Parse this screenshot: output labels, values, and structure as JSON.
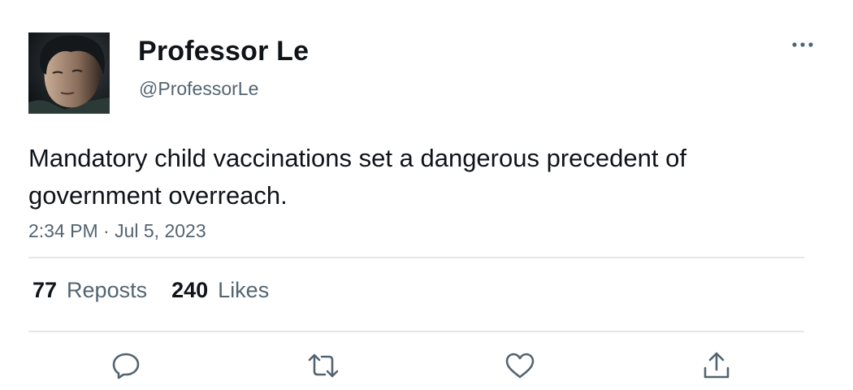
{
  "tweet": {
    "author": {
      "display_name": "Professor Le",
      "handle": "@ProfessorLe"
    },
    "text": "Mandatory child vaccinations set a dangerous precedent of government overreach.",
    "timestamp": "2:34 PM · Jul 5, 2023",
    "stats": {
      "reposts_count": "77",
      "reposts_label": "Reposts",
      "likes_count": "240",
      "likes_label": "Likes"
    },
    "actions": [
      "reply-icon",
      "retweet-icon",
      "like-icon",
      "share-icon"
    ],
    "more_icon": "more-horizontal-icon"
  },
  "colors": {
    "text_primary": "#0f1419",
    "text_secondary": "#536471",
    "divider": "#e4e8eb",
    "background": "#ffffff"
  }
}
